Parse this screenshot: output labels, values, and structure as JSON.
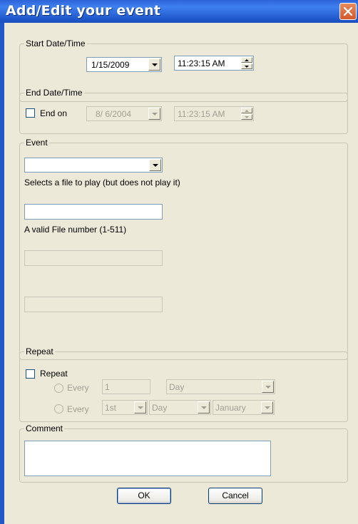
{
  "window": {
    "title": "Add/Edit your event"
  },
  "start": {
    "legend": "Start Date/Time",
    "date": "1/15/2009",
    "time": "11:23:15 AM"
  },
  "end": {
    "legend": "End Date/Time",
    "checkbox_label": "End on",
    "checked": false,
    "date": "8/ 6/2004",
    "time": "11:23:15 AM"
  },
  "event": {
    "legend": "Event",
    "file_select_value": "",
    "file_hint": "Selects a file to play (but does not play it)",
    "file_number_value": "",
    "file_number_hint": "A valid File number (1-511)"
  },
  "repeat": {
    "legend": "Repeat",
    "checkbox_label": "Repeat",
    "checked": false,
    "row1": {
      "radio_label": "Every",
      "count": "1",
      "unit": "Day"
    },
    "row2": {
      "radio_label": "Every",
      "ordinal": "1st",
      "unit": "Day",
      "month": "January"
    }
  },
  "comment": {
    "legend": "Comment",
    "value": ""
  },
  "buttons": {
    "ok": "OK",
    "cancel": "Cancel"
  },
  "colors": {
    "title_bar": "#2d63d8",
    "close_button": "#d35a2a",
    "dialog_bg": "#ece9d8"
  },
  "icons": {
    "close": "close-icon"
  }
}
